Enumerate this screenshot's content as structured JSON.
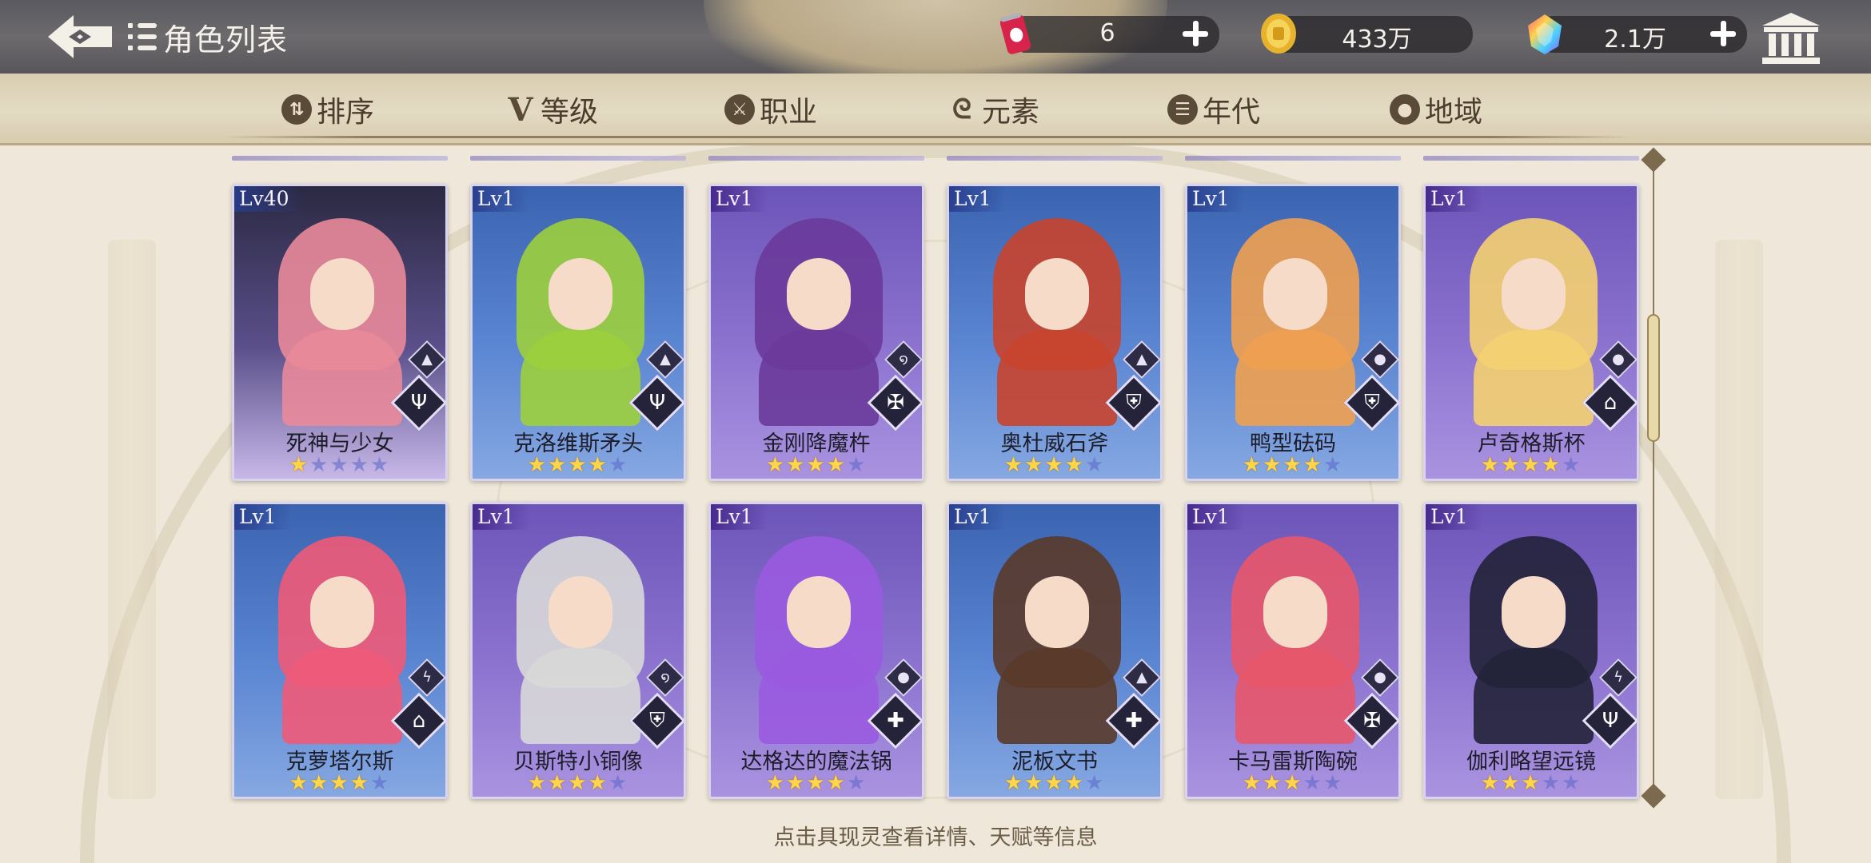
{
  "header": {
    "back_icon": "back-arrow-icon",
    "title": "角色列表",
    "title_icon": "list-icon",
    "currencies": [
      {
        "icon": "soda-can-icon",
        "value": "6"
      },
      {
        "icon": "gold-coin-icon",
        "value": "433万"
      },
      {
        "icon": "rainbow-gem-icon",
        "value": "2.1万"
      }
    ],
    "museum_icon": "museum-icon"
  },
  "filters": [
    {
      "label": "排序",
      "icon": "sort-icon"
    },
    {
      "label": "等级",
      "icon": "level-v-icon"
    },
    {
      "label": "职业",
      "icon": "class-icon"
    },
    {
      "label": "元素",
      "icon": "element-swirl-icon"
    },
    {
      "label": "年代",
      "icon": "era-icon"
    },
    {
      "label": "地域",
      "icon": "location-pin-icon"
    }
  ],
  "cards": [
    {
      "level": "Lv40",
      "name": "死神与少女",
      "stars": 1,
      "max_stars": 5,
      "element_icon": "mountain-icon",
      "class_icon": "fork-icon",
      "theme": "special",
      "accent": "#e98a9a"
    },
    {
      "level": "Lv1",
      "name": "克洛维斯矛头",
      "stars": 4,
      "max_stars": 5,
      "element_icon": "mountain-icon",
      "class_icon": "fork-icon",
      "theme": "blue",
      "accent": "#9ccf3c"
    },
    {
      "level": "Lv1",
      "name": "金刚降魔杵",
      "stars": 4,
      "max_stars": 5,
      "element_icon": "swirl-icon",
      "class_icon": "sword-wings-icon",
      "theme": "purple",
      "accent": "#6a3a9a"
    },
    {
      "level": "Lv1",
      "name": "奥杜威石斧",
      "stars": 4,
      "max_stars": 5,
      "element_icon": "mountain-icon",
      "class_icon": "shield-icon",
      "theme": "blue",
      "accent": "#c8442c"
    },
    {
      "level": "Lv1",
      "name": "鸭型砝码",
      "stars": 4,
      "max_stars": 5,
      "element_icon": "water-drop-icon",
      "class_icon": "shield-icon",
      "theme": "blue",
      "accent": "#f0a050"
    },
    {
      "level": "Lv1",
      "name": "卢奇格斯杯",
      "stars": 4,
      "max_stars": 5,
      "element_icon": "water-drop-icon",
      "class_icon": "book-icon",
      "theme": "purple",
      "accent": "#f4d070"
    },
    {
      "level": "Lv1",
      "name": "克萝塔尔斯",
      "stars": 4,
      "max_stars": 5,
      "element_icon": "lightning-icon",
      "class_icon": "book-icon",
      "theme": "blue",
      "accent": "#ef5a78"
    },
    {
      "level": "Lv1",
      "name": "贝斯特小铜像",
      "stars": 4,
      "max_stars": 5,
      "element_icon": "swirl-icon",
      "class_icon": "shield-icon",
      "theme": "purple",
      "accent": "#d8d8d8"
    },
    {
      "level": "Lv1",
      "name": "达格达的魔法锅",
      "stars": 4,
      "max_stars": 5,
      "element_icon": "water-drop-icon",
      "class_icon": "cross-icon",
      "theme": "purple",
      "accent": "#9a5ae0"
    },
    {
      "level": "Lv1",
      "name": "泥板文书",
      "stars": 4,
      "max_stars": 5,
      "element_icon": "mountain-icon",
      "class_icon": "cross-icon",
      "theme": "blue",
      "accent": "#5a3a2a"
    },
    {
      "level": "Lv1",
      "name": "卡马雷斯陶碗",
      "stars": 3,
      "max_stars": 5,
      "element_icon": "water-drop-icon",
      "class_icon": "sword-wings-icon",
      "theme": "purple",
      "accent": "#e8566a"
    },
    {
      "level": "Lv1",
      "name": "伽利略望远镜",
      "stars": 3,
      "max_stars": 5,
      "element_icon": "lightning-icon",
      "class_icon": "fork-icon",
      "theme": "purple",
      "accent": "#222238"
    }
  ],
  "hint": "点击具现灵查看详情、天赋等信息",
  "colors": {
    "header_bg": "#5f5d62",
    "tab_bar_bg": "#e0d6bd",
    "star_on": "#ffd64a",
    "star_off": "#6e74c8"
  }
}
